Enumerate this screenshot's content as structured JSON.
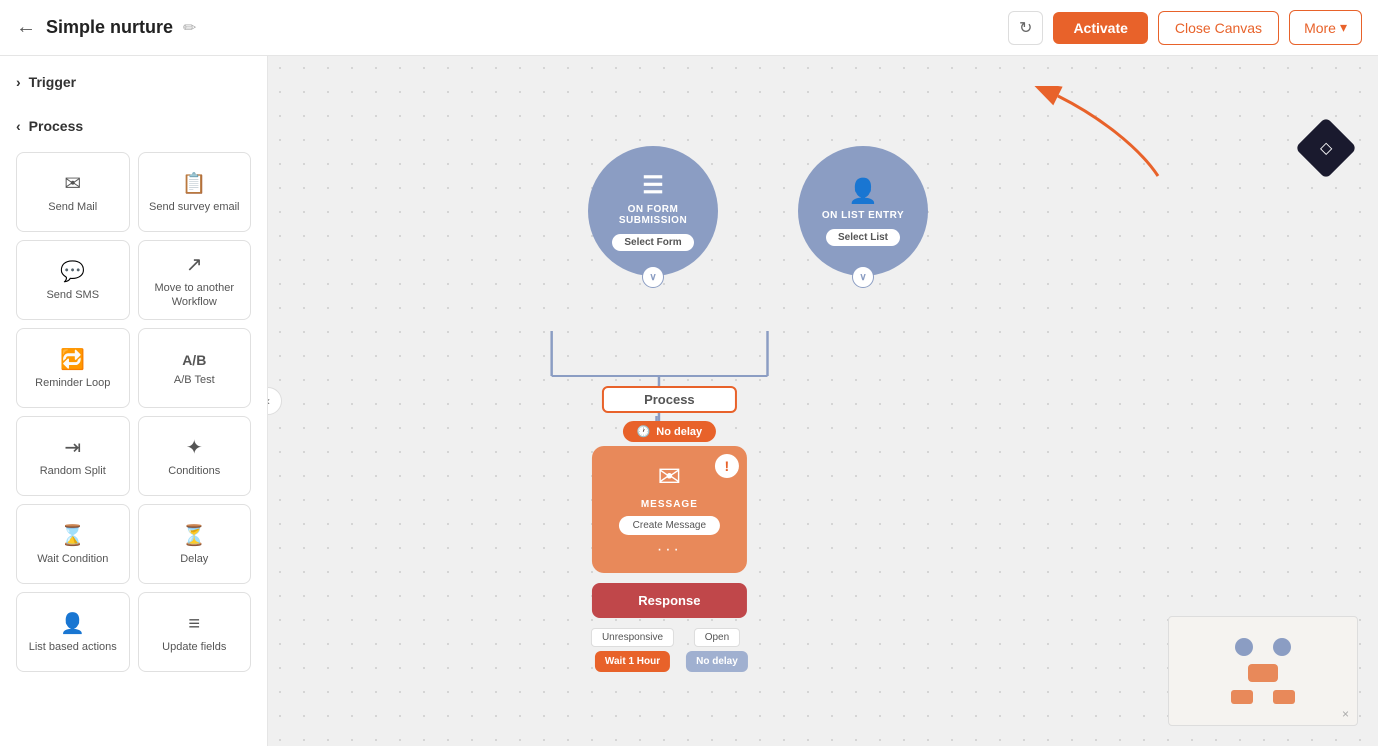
{
  "header": {
    "back_icon": "←",
    "title": "Simple nurture",
    "edit_icon": "✏",
    "refresh_icon": "↻",
    "activate_label": "Activate",
    "close_canvas_label": "Close Canvas",
    "more_label": "More",
    "more_icon": "▾"
  },
  "sidebar": {
    "trigger_section": {
      "label": "Trigger",
      "chevron": "›"
    },
    "process_section": {
      "label": "Process",
      "chevron": "‹"
    },
    "items": [
      {
        "id": "send-mail",
        "label": "Send Mail",
        "icon": "✉"
      },
      {
        "id": "send-survey-email",
        "label": "Send survey email",
        "icon": "📋"
      },
      {
        "id": "send-sms",
        "label": "Send SMS",
        "icon": "💬"
      },
      {
        "id": "move-to-workflow",
        "label": "Move to another Workflow",
        "icon": "↗"
      },
      {
        "id": "reminder-loop",
        "label": "Reminder Loop",
        "icon": "🔁"
      },
      {
        "id": "ab-test",
        "label": "A/B Test",
        "icon": "A/B"
      },
      {
        "id": "random-split",
        "label": "Random Split",
        "icon": "⇥"
      },
      {
        "id": "conditions",
        "label": "Conditions",
        "icon": "✦"
      },
      {
        "id": "wait-condition",
        "label": "Wait Condition",
        "icon": "⌛"
      },
      {
        "id": "delay",
        "label": "Delay",
        "icon": "⏳"
      },
      {
        "id": "list-based-actions",
        "label": "List based actions",
        "icon": "👤"
      },
      {
        "id": "update-fields",
        "label": "Update fields",
        "icon": "≡"
      }
    ]
  },
  "canvas": {
    "trigger_nodes": [
      {
        "id": "form-submission",
        "icon": "☰",
        "label": "ON FORM\nSUBMISSION",
        "button": "Select Form"
      },
      {
        "id": "list-entry",
        "icon": "👤",
        "label": "ON LIST ENTRY",
        "button": "Select List"
      }
    ],
    "process_label": "Process",
    "no_delay_label": "No delay",
    "no_delay_icon": "🕐",
    "message_node": {
      "type_label": "MESSAGE",
      "button_label": "Create Message",
      "icon": "✉",
      "warning": "!"
    },
    "response_label": "Response",
    "branches": [
      {
        "label": "Unresponsive",
        "action": "Wait 1 Hour",
        "color": "orange"
      },
      {
        "label": "Open",
        "action": "No delay",
        "color": "blue"
      }
    ]
  },
  "minimap": {
    "close_icon": "×"
  },
  "colors": {
    "activate": "#e8622a",
    "trigger_node_bg": "#8b9dc3",
    "message_node_bg": "#e8895a",
    "response_node_bg": "#c0474a",
    "branch_orange": "#e8622a",
    "branch_blue": "#a0b0d0"
  }
}
